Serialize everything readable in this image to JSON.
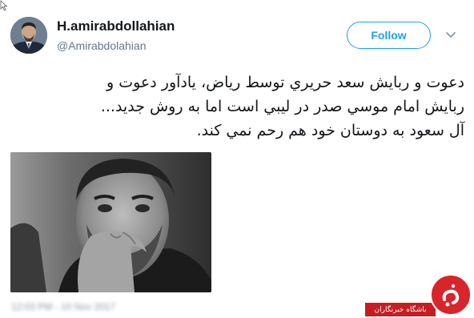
{
  "tweet": {
    "display_name": "H.amirabdollahian",
    "handle": "@Amirabdolahian",
    "follow_label": "Follow",
    "text_lines": [
      "دعوت و ربايش سعد حريري توسط رياض، يادآور دعوت و",
      "ربايش امام موسي صدر در ليبي است اما به روش جديد...",
      "آل سعود به دوستان خود هم رحم نمي كند."
    ],
    "timestamp": "12:03 PM - 10 Nov 2017"
  },
  "watermark": {
    "label": "باشگاه خبرنگاران",
    "icon": "jaam-logo-icon"
  },
  "colors": {
    "accent": "#1da1f2",
    "name_text": "#14171a",
    "secondary_text": "#657786",
    "watermark_red": "#d7252b"
  }
}
